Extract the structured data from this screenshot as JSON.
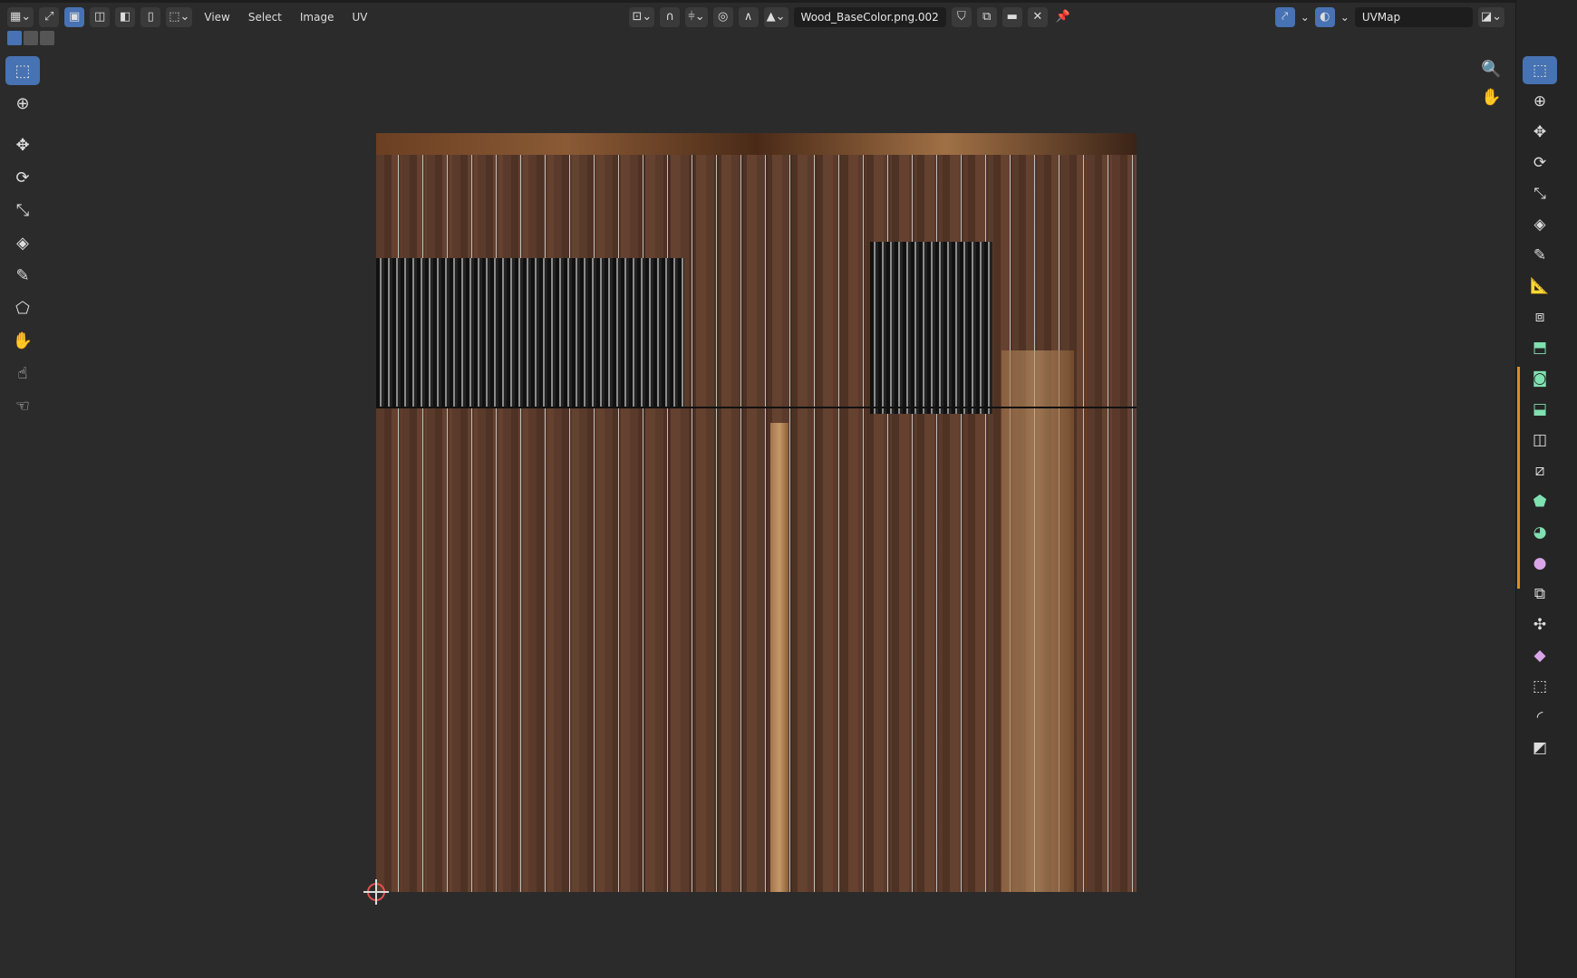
{
  "header": {
    "menus": [
      "View",
      "Select",
      "Image",
      "UV"
    ],
    "image_name": "Wood_BaseColor.png.002",
    "uv_map": "UVMap"
  },
  "icons": {
    "editor": "uv-editor-icon",
    "sync": "sync-selection-icon",
    "pin": "pin-icon",
    "close": "close-icon"
  },
  "left_tools": [
    "select-box",
    "cursor",
    "move",
    "rotate",
    "scale",
    "transform",
    "annotate",
    "rip-region",
    "grab",
    "relax",
    "pinch"
  ],
  "right_tools": [
    "select-box",
    "cursor",
    "move",
    "rotate",
    "scale",
    "transform",
    "annotate",
    "measure",
    "add-cube",
    "extrude",
    "inset",
    "bevel",
    "loop-cut",
    "knife",
    "poly-build",
    "spin",
    "smooth",
    "edge-slide",
    "shrink-fatten",
    "shear",
    "rip",
    "to-sphere"
  ],
  "colors": {
    "accent": "#4772b3",
    "bg": "#2b2b2b",
    "orange": "#e08a1e"
  }
}
